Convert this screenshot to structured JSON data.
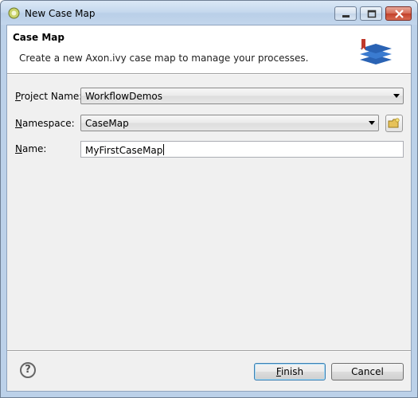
{
  "window": {
    "title": "New Case Map",
    "controls": {
      "minimize": "minimize",
      "maximize": "maximize",
      "close": "close"
    }
  },
  "header": {
    "title": "Case Map",
    "description": "Create a new Axon.ivy case map to manage your processes."
  },
  "form": {
    "project_name": {
      "label_underlined": "P",
      "label_rest": "roject Name:",
      "value": "WorkflowDemos"
    },
    "namespace": {
      "label_underlined": "N",
      "label_rest": "amespace:",
      "value": "CaseMap"
    },
    "name": {
      "label_underlined": "N",
      "label_rest": "ame:",
      "value": "MyFirstCaseMap"
    }
  },
  "footer": {
    "help_glyph": "?",
    "finish": {
      "underlined": "F",
      "rest": "inish"
    },
    "cancel": "Cancel"
  },
  "icons": {
    "app": "eclipse-wizard-icon",
    "logo": "case-map-logo-icon",
    "namespace_browse": "new-folder-icon",
    "help": "help-icon"
  },
  "colors": {
    "accent": "#3c7fb1",
    "logo_blue": "#2a63b4",
    "logo_red": "#c0392b"
  }
}
